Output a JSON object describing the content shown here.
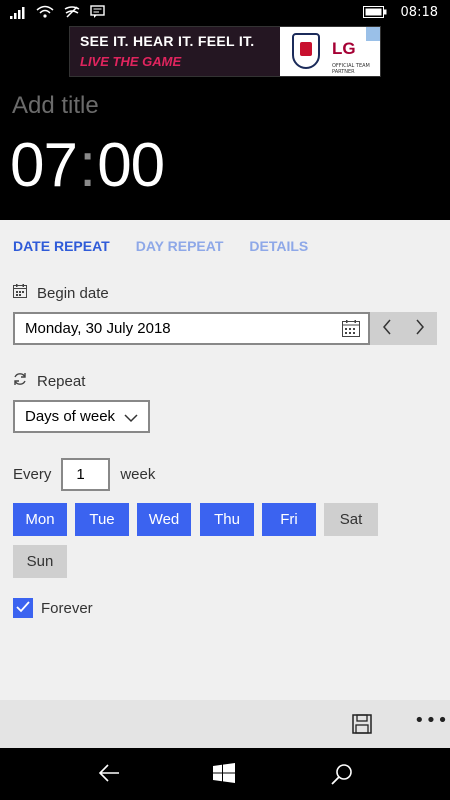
{
  "status_bar": {
    "time": "08:18"
  },
  "ad": {
    "line1": "SEE IT. HEAR IT. FEEL IT.",
    "line2": "LIVE THE GAME",
    "brand": "LG",
    "brand_sub": "OFFICIAL TEAM PARTNER"
  },
  "header": {
    "title_placeholder": "Add title",
    "time_hours": "07",
    "time_colon": ":",
    "time_minutes": "00"
  },
  "tabs": [
    {
      "label": "DATE REPEAT",
      "active": true
    },
    {
      "label": "DAY REPEAT",
      "active": false
    },
    {
      "label": "DETAILS",
      "active": false
    }
  ],
  "begin_date": {
    "label": "Begin date",
    "value": "Monday, 30 July 2018"
  },
  "repeat": {
    "label": "Repeat",
    "selected": "Days of week"
  },
  "every": {
    "prefix": "Every",
    "value": "1",
    "suffix": "week"
  },
  "days": [
    {
      "label": "Mon",
      "selected": true
    },
    {
      "label": "Tue",
      "selected": true
    },
    {
      "label": "Wed",
      "selected": true
    },
    {
      "label": "Thu",
      "selected": true
    },
    {
      "label": "Fri",
      "selected": true
    },
    {
      "label": "Sat",
      "selected": false
    },
    {
      "label": "Sun",
      "selected": false
    }
  ],
  "forever": {
    "label": "Forever",
    "checked": true
  },
  "colors": {
    "accent": "#3b63f0",
    "tab_active": "#2f5bd8",
    "tab_inactive": "#8ea8e8"
  }
}
